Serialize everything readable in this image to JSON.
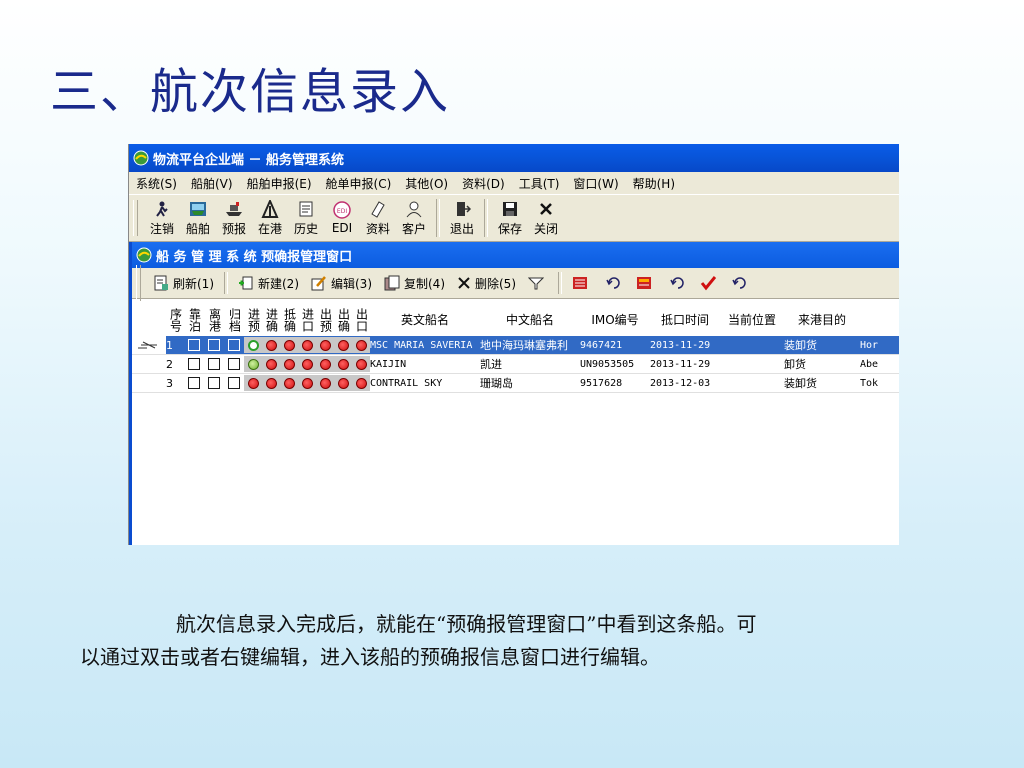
{
  "slide": {
    "title": "三、航次信息录入",
    "caption_line1": "航次信息录入完成后，就能在“预确报管理窗口”中看到这条船。可",
    "caption_line2": "以通过双击或者右键编辑，进入该船的预确报信息窗口进行编辑。"
  },
  "app": {
    "title": "物流平台企业端 － 船务管理系统",
    "menu": [
      "系统(S)",
      "船舶(V)",
      "船舶申报(E)",
      "舱单申报(C)",
      "其他(O)",
      "资料(D)",
      "工具(T)",
      "窗口(W)",
      "帮助(H)"
    ],
    "toolbar": [
      {
        "label": "注销",
        "icon": "logout-icon"
      },
      {
        "label": "船舶",
        "icon": "ship-icon"
      },
      {
        "label": "预报",
        "icon": "forecast-icon"
      },
      {
        "label": "在港",
        "icon": "in-port-icon"
      },
      {
        "label": "历史",
        "icon": "history-icon"
      },
      {
        "label": "EDI",
        "icon": "edi-icon"
      },
      {
        "label": "资料",
        "icon": "documents-icon"
      },
      {
        "label": "客户",
        "icon": "customer-icon"
      },
      {
        "label": "退出",
        "icon": "exit-icon"
      },
      {
        "label": "保存",
        "icon": "save-icon"
      },
      {
        "label": "关闭",
        "icon": "close-icon"
      }
    ]
  },
  "window": {
    "title": "船 务 管 理 系 统 预确报管理窗口",
    "tools": {
      "refresh": "刷新(1)",
      "new": "新建(2)",
      "edit": "编辑(3)",
      "copy": "复制(4)",
      "delete": "删除(5)"
    }
  },
  "grid": {
    "columns": {
      "seq": "序号",
      "berth": "靠泊",
      "depart": "离港",
      "archive": "归档",
      "in_forecast": "进预",
      "in_confirm": "进确",
      "arrive_confirm": "抵确",
      "in_port": "进口",
      "out_forecast": "出预",
      "out_confirm": "出确",
      "out_port": "出口",
      "en_name": "英文船名",
      "cn_name": "中文船名",
      "imo": "IMO编号",
      "arrival": "抵口时间",
      "position": "当前位置",
      "purpose": "来港目的"
    },
    "rows": [
      {
        "seq": "1",
        "en": "MSC MARIA SAVERIA",
        "cn": "地中海玛琳塞弗利",
        "imo": "9467421",
        "date": "2013-11-29",
        "pos": "",
        "purpose": "装卸货",
        "extra": "Hor",
        "first": "green"
      },
      {
        "seq": "2",
        "en": "KAIJIN",
        "cn": "凯进",
        "imo": "UN9053505",
        "date": "2013-11-29",
        "pos": "",
        "purpose": "卸货",
        "extra": "Abe",
        "first": "ok"
      },
      {
        "seq": "3",
        "en": "CONTRAIL SKY",
        "cn": "珊瑚岛",
        "imo": "9517628",
        "date": "2013-12-03",
        "pos": "",
        "purpose": "装卸货",
        "extra": "Tok",
        "first": "red"
      }
    ]
  },
  "colors": {
    "title_text": "#1a2a8c",
    "titlebar_blue": "#0a5ce8",
    "selection": "#316ac5",
    "status_red": "#d01010",
    "status_green": "#2aa02a"
  }
}
